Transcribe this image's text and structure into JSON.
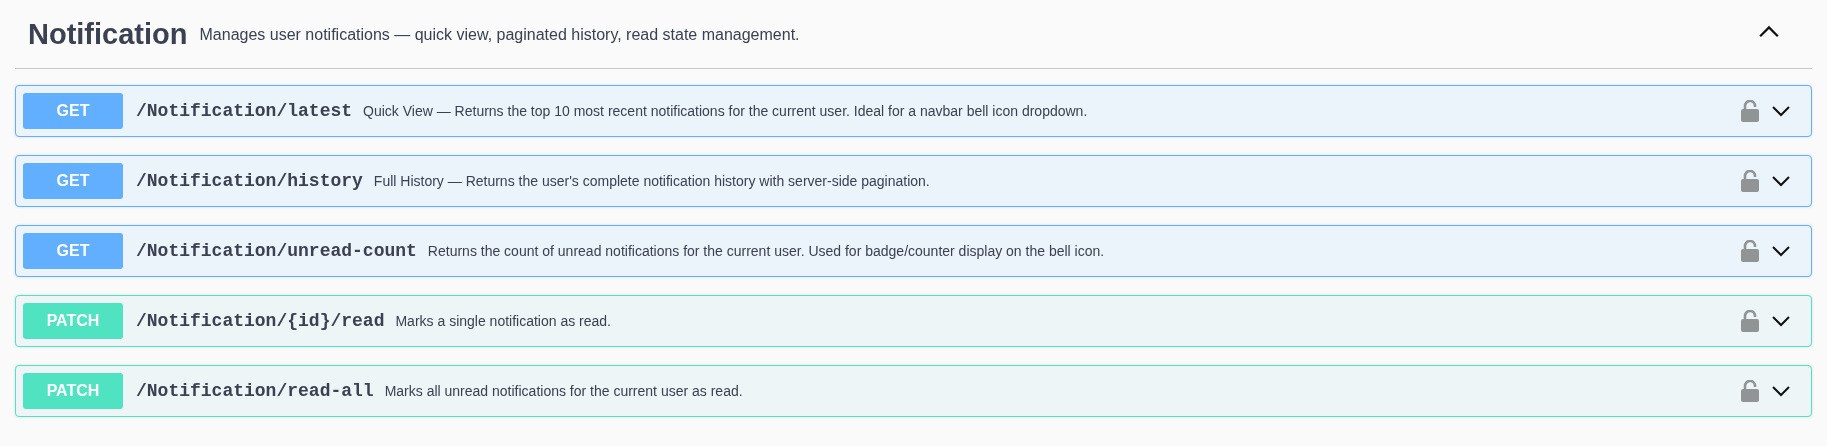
{
  "section": {
    "title": "Notification",
    "description": "Manages user notifications — quick view, paginated history, read state management.",
    "expanded": true
  },
  "operations": [
    {
      "kind": "get",
      "method": "GET",
      "path": "/Notification/latest",
      "summary": "Quick View — Returns the top 10 most recent notifications for the current user. Ideal for a navbar bell icon dropdown.",
      "expanded": false
    },
    {
      "kind": "get",
      "method": "GET",
      "path": "/Notification/history",
      "summary": "Full History — Returns the user's complete notification history with server-side pagination.",
      "expanded": false
    },
    {
      "kind": "get",
      "method": "GET",
      "path": "/Notification/unread-count",
      "summary": "Returns the count of unread notifications for the current user. Used for badge/counter display on the bell icon.",
      "expanded": false
    },
    {
      "kind": "patch",
      "method": "PATCH",
      "path": "/Notification/{id}/read",
      "summary": "Marks a single notification as read.",
      "expanded": false
    },
    {
      "kind": "patch",
      "method": "PATCH",
      "path": "/Notification/read-all",
      "summary": "Marks all unread notifications for the current user as read.",
      "expanded": false
    }
  ]
}
